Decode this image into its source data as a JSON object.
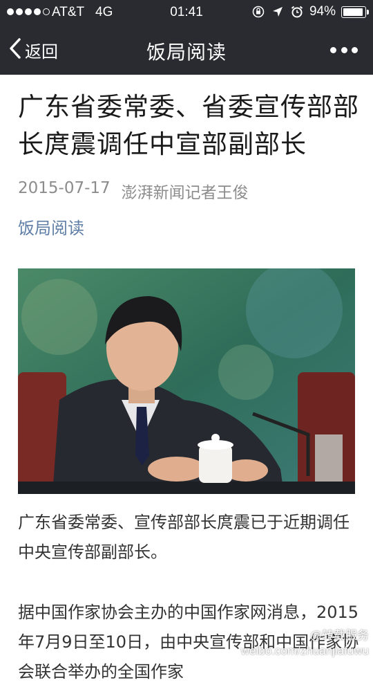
{
  "status_bar": {
    "signal_bars": 4,
    "carrier": "AT&T",
    "network": "4G",
    "time": "01:41",
    "battery_percent": "94%",
    "battery_level": 0.94,
    "icons": [
      "orientation-lock-icon",
      "location-arrow-icon",
      "alarm-clock-icon",
      "battery-icon"
    ]
  },
  "nav": {
    "back_label": "返回",
    "title": "饭局阅读",
    "more_icon": "more-dots-icon"
  },
  "article": {
    "title": "广东省委常委、省委宣传部部长庹震调任中宣部副部长",
    "date": "2015-07-17",
    "author": "澎湃新闻记者王俊",
    "account": "饭局阅读",
    "paragraphs": [
      "广东省委常委、宣传部部长庹震已于近期调任中央宣传部副部长。",
      "据中国作家协会主办的中国作家网消息，2015年7月9日至10日，由中央宣传部和中国作家协会联合举办的全国作家"
    ]
  },
  "watermark": {
    "line1": "@转载服务",
    "line2": "weibo.com/zhuanjiafuwu"
  },
  "colors": {
    "bar_background": "#2a2b30",
    "link_blue": "#607fa6",
    "meta_gray": "#8c8c8c",
    "text": "#333333"
  }
}
